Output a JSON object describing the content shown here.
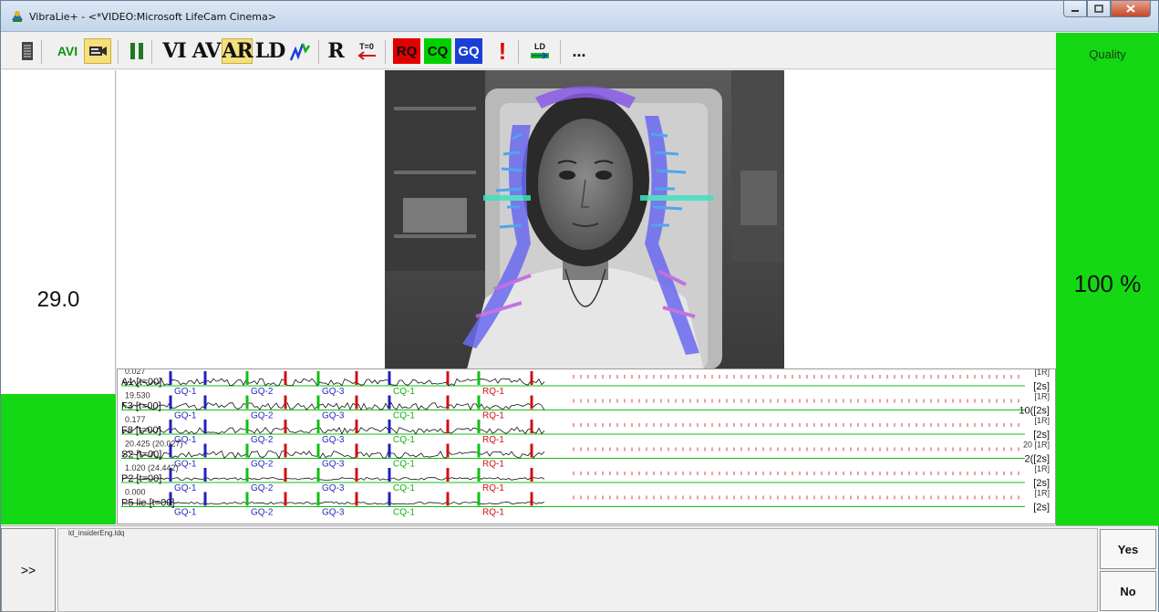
{
  "window": {
    "title": "VibraLie+ - <*VIDEO:Microsoft LifeCam Cinema>"
  },
  "toolbar": {
    "avi": "AVI",
    "vi": "VI",
    "av": "AV",
    "ar": "AR",
    "ld": "LD",
    "r": "R",
    "t0": "T=0",
    "rq": "RQ",
    "cq": "CQ",
    "gq": "GQ",
    "exclaim": "!",
    "ld_small": "LD",
    "more": "..."
  },
  "left_panel": {
    "rate": "29.0"
  },
  "right_panel": {
    "quality_label": "Quality",
    "quality_value": "100 %"
  },
  "bottom": {
    "expand_label": ">>",
    "file_label": "ld_insiderEng.ldq",
    "yes_label": "Yes",
    "no_label": "No"
  },
  "chart_data": {
    "type": "line",
    "channels": [
      {
        "top": "0.027",
        "label": "A1 [t=00]",
        "right_top": "[1R]",
        "right": "[2s]"
      },
      {
        "top": "19.530",
        "label": "F3 [t=00]",
        "right_top": "[1R]",
        "right": "10([2s]"
      },
      {
        "top": "0.177",
        "label": "F8 [t=00]",
        "right_top": "[1R]",
        "right": "[2s]"
      },
      {
        "top": "20.425 (20.027)",
        "label": "S2 [t=00]",
        "right_top": "20 [1R]",
        "right": "2([2s]"
      },
      {
        "top": "1.020 (24.442)",
        "label": "P2 [t=00]",
        "right_top": "[1R]",
        "right": "[2s]"
      },
      {
        "top": "0.000",
        "label": "P5 lie [t=00]",
        "right_top": "[1R]",
        "right": "[2s]"
      }
    ],
    "question_markers": [
      "GQ-1",
      "GQ-2",
      "GQ-3",
      "CQ-1",
      "RQ-1"
    ],
    "marker_colors": {
      "GQ": "#2020c0",
      "CQ": "#10c010",
      "RQ": "#d01010",
      "baseline": "#10c010"
    }
  },
  "colors": {
    "green": "#13d813",
    "rq": "#e00000",
    "cq": "#00c000",
    "gq": "#1a3fd6"
  }
}
